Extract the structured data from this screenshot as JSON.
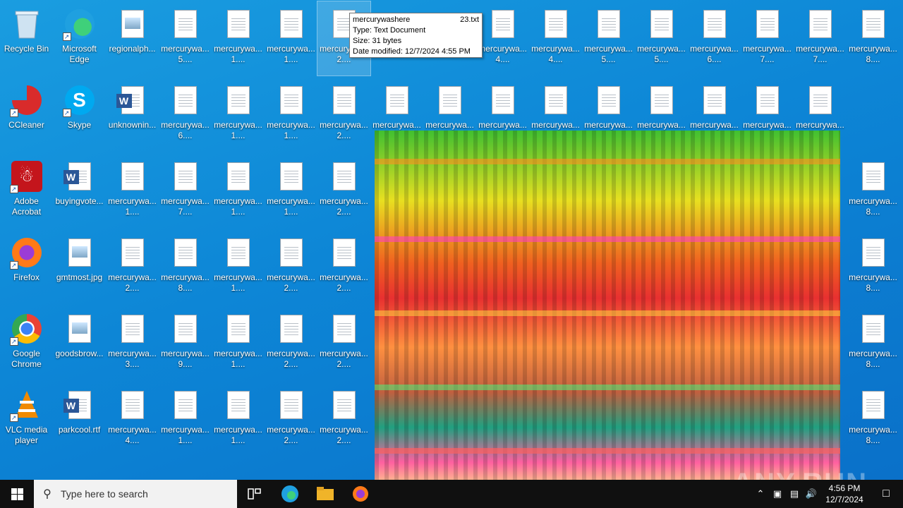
{
  "desktop": {
    "icons": [
      {
        "label": "Recycle Bin",
        "kind": "recycle"
      },
      {
        "label": "Microsoft Edge",
        "kind": "edge"
      },
      {
        "label": "regionalph...",
        "kind": "pic"
      },
      {
        "label": "mercurywa... 5....",
        "kind": "txt"
      },
      {
        "label": "mercurywa... 1....",
        "kind": "txt"
      },
      {
        "label": "mercurywa... 1....",
        "kind": "txt"
      },
      {
        "label": "mercurywa... 2....",
        "kind": "txt",
        "selected": true
      },
      {
        "label": "mercurywa... 4....",
        "kind": "txt"
      },
      {
        "label": "mercurywa... 4....",
        "kind": "txt"
      },
      {
        "label": "mercurywa... 5....",
        "kind": "txt"
      },
      {
        "label": "mercurywa... 5....",
        "kind": "txt"
      },
      {
        "label": "mercurywa... 6....",
        "kind": "txt"
      },
      {
        "label": "mercurywa... 7....",
        "kind": "txt"
      },
      {
        "label": "mercurywa... 7....",
        "kind": "txt"
      },
      {
        "label": "mercurywa... 8....",
        "kind": "txt"
      },
      {
        "label": "CCleaner",
        "kind": "ccleaner"
      },
      {
        "label": "Skype",
        "kind": "skype"
      },
      {
        "label": "unknownin...",
        "kind": "word"
      },
      {
        "label": "mercurywa... 6....",
        "kind": "txt"
      },
      {
        "label": "mercurywa... 1....",
        "kind": "txt"
      },
      {
        "label": "mercurywa... 1....",
        "kind": "txt"
      },
      {
        "label": "mercurywa... 2....",
        "kind": "txt"
      },
      {
        "label": "mercurywa...",
        "kind": "txt"
      },
      {
        "label": "mercurywa...",
        "kind": "txt"
      },
      {
        "label": "mercurywa...",
        "kind": "txt"
      },
      {
        "label": "mercurywa...",
        "kind": "txt"
      },
      {
        "label": "mercurywa...",
        "kind": "txt"
      },
      {
        "label": "mercurywa...",
        "kind": "txt"
      },
      {
        "label": "mercurywa...",
        "kind": "txt"
      },
      {
        "label": "mercurywa...",
        "kind": "txt"
      },
      {
        "label": "mercurywa... 8....",
        "kind": "txt"
      },
      {
        "label": "Adobe Acrobat",
        "kind": "acrobat"
      },
      {
        "label": "buyingvote...",
        "kind": "word"
      },
      {
        "label": "mercurywa... 1....",
        "kind": "txt"
      },
      {
        "label": "mercurywa... 7....",
        "kind": "txt"
      },
      {
        "label": "mercurywa... 1....",
        "kind": "txt"
      },
      {
        "label": "mercurywa... 1....",
        "kind": "txt"
      },
      {
        "label": "mercurywa... 2....",
        "kind": "txt"
      },
      {
        "label": "mercurywa... 8....",
        "kind": "txt"
      },
      {
        "label": "Firefox",
        "kind": "firefox"
      },
      {
        "label": "gmtmost.jpg",
        "kind": "pic"
      },
      {
        "label": "mercurywa... 2....",
        "kind": "txt"
      },
      {
        "label": "mercurywa... 8....",
        "kind": "txt"
      },
      {
        "label": "mercurywa... 1....",
        "kind": "txt"
      },
      {
        "label": "mercurywa... 2....",
        "kind": "txt"
      },
      {
        "label": "mercurywa... 2....",
        "kind": "txt"
      },
      {
        "label": "mercurywa... 8....",
        "kind": "txt"
      },
      {
        "label": "Google Chrome",
        "kind": "chrome"
      },
      {
        "label": "goodsbrow...",
        "kind": "pic"
      },
      {
        "label": "mercurywa... 3....",
        "kind": "txt"
      },
      {
        "label": "mercurywa... 9....",
        "kind": "txt"
      },
      {
        "label": "mercurywa... 1....",
        "kind": "txt"
      },
      {
        "label": "mercurywa... 2....",
        "kind": "txt"
      },
      {
        "label": "mercurywa... 2....",
        "kind": "txt"
      },
      {
        "label": "mercurywa... 8....",
        "kind": "txt"
      },
      {
        "label": "VLC media player",
        "kind": "vlc"
      },
      {
        "label": "parkcool.rtf",
        "kind": "word"
      },
      {
        "label": "mercurywa... 4....",
        "kind": "txt"
      },
      {
        "label": "mercurywa... 1....",
        "kind": "txt"
      },
      {
        "label": "mercurywa... 1....",
        "kind": "txt"
      },
      {
        "label": "mercurywa... 2....",
        "kind": "txt"
      },
      {
        "label": "mercurywa... 2....",
        "kind": "txt"
      },
      {
        "label": "mercurywa... 8....",
        "kind": "txt"
      }
    ]
  },
  "tooltip": {
    "name": "mercurywashere",
    "ext": "23.txt",
    "type": "Type: Text Document",
    "size": "Size: 31 bytes",
    "modified": "Date modified: 12/7/2024 4:55 PM"
  },
  "watermark": "ANY.RUN",
  "taskbar": {
    "search_placeholder": "Type here to search",
    "time": "4:56 PM",
    "date": "12/7/2024"
  },
  "colors": {
    "taskbar_bg": "#101010",
    "desktop_accent": "#0d86d6"
  }
}
